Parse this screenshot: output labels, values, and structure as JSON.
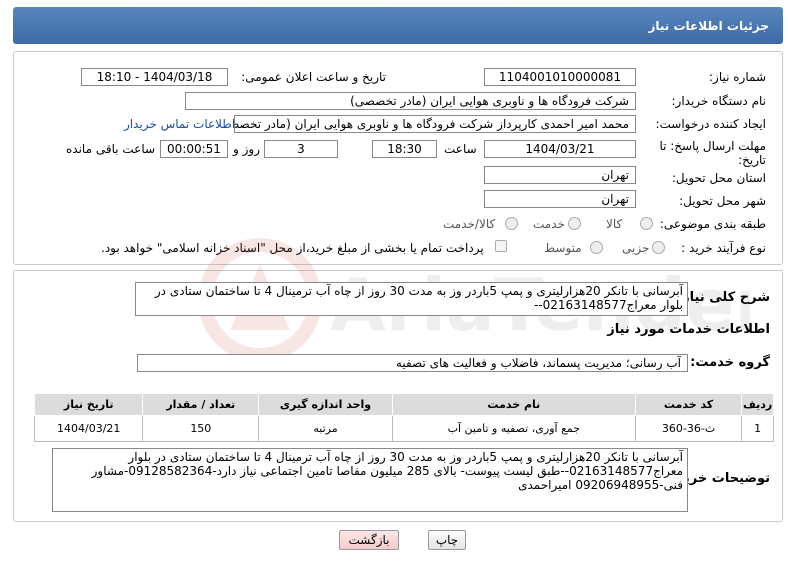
{
  "header": {
    "title": "جزئیات اطلاعات نیاز"
  },
  "form": {
    "need_number_label": "شماره نیاز:",
    "need_number": "1104001010000081",
    "announce_label": "تاریخ و ساعت اعلان عمومی:",
    "announce_value": "1404/03/18 - 18:10",
    "buyer_label": "نام دستگاه خریدار:",
    "buyer_value": "شرکت فرودگاه ها و ناوبری هوایی ایران (مادر تخصصی)",
    "creator_label": "ایجاد کننده درخواست:",
    "creator_value": "محمد امیر احمدی کارپرداز شرکت فرودگاه ها و ناوبری هوایی ایران (مادر تخصصی)",
    "contact_link": "اطلاعات تماس خریدار",
    "deadline_label": "مهلت ارسال پاسخ: تا تاریخ:",
    "deadline_date": "1404/03/21",
    "time_label": "ساعت",
    "deadline_time": "18:30",
    "days_value": "3",
    "days_label": "روز و",
    "remaining_value": "00:00:51",
    "remaining_label": "ساعت باقی مانده",
    "province_label": "استان محل تحویل:",
    "province_value": "تهران",
    "city_label": "شهر محل تحویل:",
    "city_value": "تهران",
    "category_label": "طبقه بندی موضوعی:",
    "category_options": [
      "کالا",
      "خدمت",
      "کالا/خدمت"
    ],
    "process_label": "نوع فرآیند خرید :",
    "process_options": [
      "جزیی",
      "متوسط"
    ],
    "payment_note": "پرداخت تمام یا بخشی از مبلغ خرید،از محل \"اسناد خزانه اسلامی\" خواهد بود."
  },
  "summary": {
    "label": "شرح کلی نیاز:",
    "text": "آبرسانی با تانکر 20هزارلیتری و پمپ 5باردر وز به مدت 30 روز از چاه آب ترمینال 4 تا ساختمان ستادی در بلوار معراج02163148577--"
  },
  "services": {
    "section_title": "اطلاعات خدمات مورد نیاز",
    "group_label": "گروه خدمت:",
    "group_value": "آب رسانی؛ مدیریت پسماند، فاضلاب و فعالیت های تصفیه",
    "columns": [
      "ردیف",
      "کد خدمت",
      "نام خدمت",
      "واحد اندازه گیری",
      "تعداد / مقدار",
      "تاریخ نیاز"
    ],
    "rows": [
      {
        "index": "1",
        "code": "ث-36-360",
        "name": "جمع آوری، تصفیه و تامین آب",
        "unit": "مرتبه",
        "qty": "150",
        "date": "1404/03/21"
      }
    ]
  },
  "buyer_desc": {
    "label": "توضیحات خریدار:",
    "text": "آبرسانی با تانکر 20هزارلیتری و پمپ 5باردر وز به مدت 30 روز از چاه آب ترمینال 4 تا ساختمان ستادی در بلوار معراج02163148577--طبق لیست پیوست- بالای 285 میلیون مفاصا تامین اجتماعی نیاز دارد-09128582364-مشاور فنی-09206948955 امیراحمدی"
  },
  "buttons": {
    "print": "چاپ",
    "back": "بازگشت"
  },
  "watermark": {
    "text": "AriaTender.neT"
  }
}
